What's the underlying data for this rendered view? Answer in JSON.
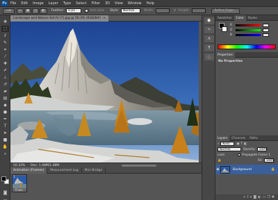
{
  "menu": {
    "app_logo": "Ps",
    "items": [
      "File",
      "Edit",
      "Image",
      "Layer",
      "Type",
      "Select",
      "Filter",
      "3D",
      "View",
      "Window",
      "Help"
    ]
  },
  "options": {
    "feather_label": "Feather:",
    "feather_value": "0 px",
    "antialias_label": "Anti-alias",
    "style_label": "Style:",
    "style_value": "Normal",
    "width_label": "Width:",
    "height_label": "Height:",
    "refine_button": "Refine Edge..."
  },
  "document": {
    "tab_title": "Landscape and Nature Set IV (7).jpg @ 50.3% (RGB/8#)",
    "zoom": "50.33%",
    "doc_size": "Doc: 1.48M/1.48M"
  },
  "bottom_panel": {
    "tabs": [
      "Animation (Frames)",
      "Measurement Log",
      "Mini Bridge"
    ],
    "frame_number": "1",
    "frame_duration": "0 sec."
  },
  "color_panel": {
    "tabs": [
      "Swatches",
      "Color",
      "Styles"
    ],
    "channels": [
      "R",
      "G",
      "B"
    ]
  },
  "properties_panel": {
    "tabs": [
      "Properties"
    ],
    "empty_label": "No Properties"
  },
  "layers_panel": {
    "tabs": [
      "Layers",
      "Channels",
      "Paths"
    ],
    "kind_label": "Kind",
    "blend_mode": "Normal",
    "opacity_label": "Opacity:",
    "opacity_value": "100%",
    "lock_label": "Lock:",
    "propagate_label": "Propagate Frame 1",
    "fill_label": "Fill:",
    "fill_value": "100%",
    "layer_name": "Background"
  },
  "tools": [
    "move",
    "marquee",
    "lasso",
    "quick-select",
    "crop",
    "eyedropper",
    "healing",
    "brush",
    "clone",
    "history",
    "eraser",
    "gradient",
    "blur",
    "dodge",
    "pen",
    "type",
    "path-select",
    "shape",
    "hand",
    "zoom"
  ],
  "colors": {
    "foreground": "#000000",
    "background": "#ffffff"
  }
}
